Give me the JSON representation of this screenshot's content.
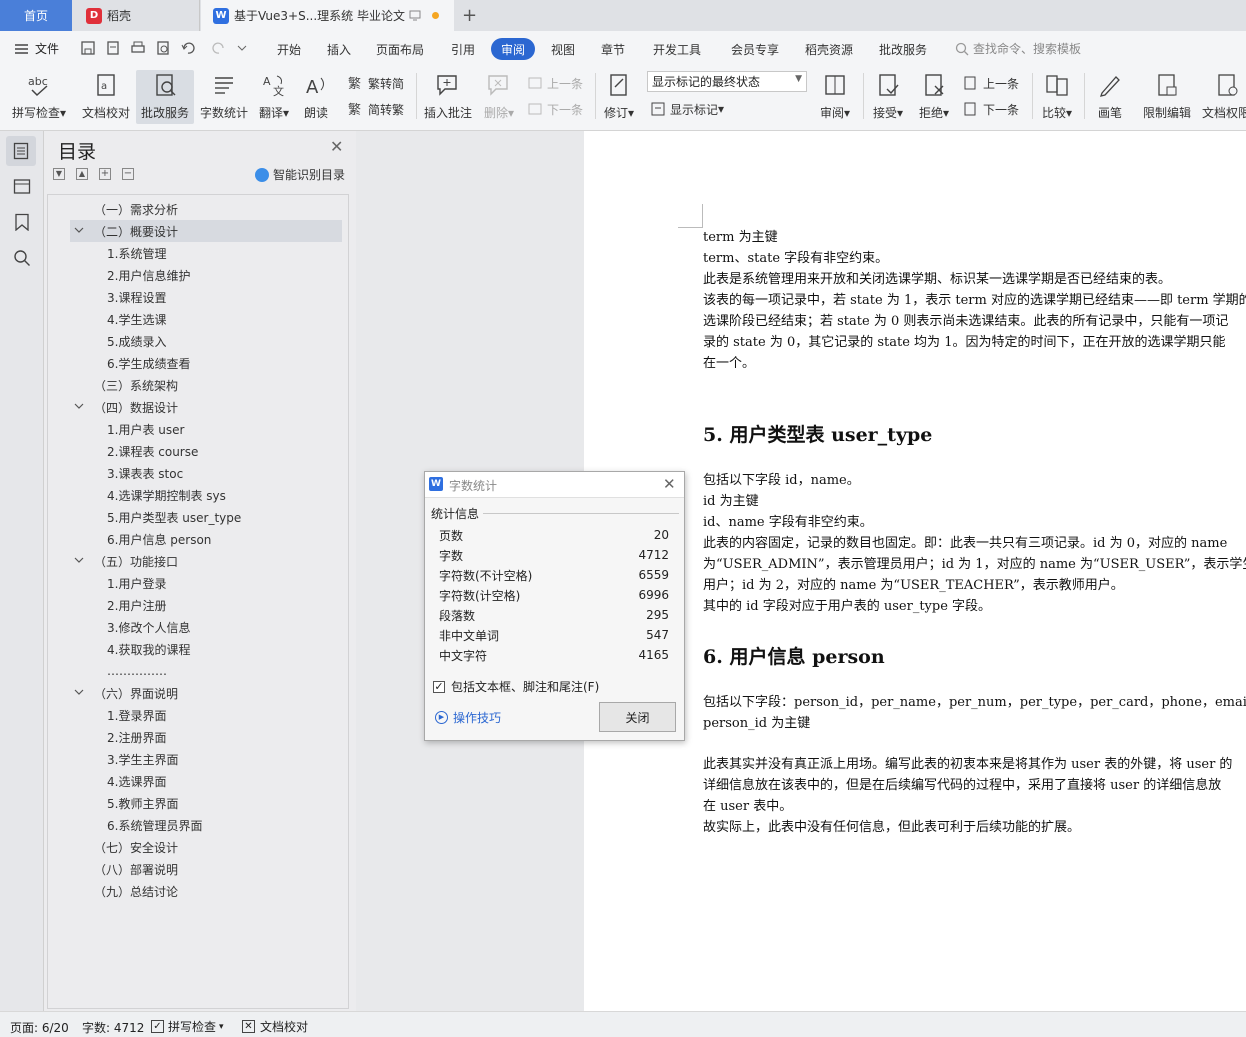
{
  "tabs": {
    "home": "首页",
    "daoke": "稻壳",
    "doc": "基于Vue3+S...理系统 毕业论文"
  },
  "menu": {
    "file": "文件",
    "items": [
      "开始",
      "插入",
      "页面布局",
      "引用",
      "审阅",
      "视图",
      "章节",
      "开发工具",
      "会员专享",
      "稻壳资源",
      "批改服务"
    ],
    "search": "查找命令、搜索模板"
  },
  "ribbon": {
    "spell": "拼写检查",
    "proof": "文档校对",
    "correct": "批改服务",
    "wordcount": "字数统计",
    "translate": "翻译",
    "read": "朗读",
    "fan2jian": "繁转简",
    "jian2fan": "简转繁",
    "insert_comment": "插入批注",
    "delete": "删除",
    "prev": "上一条",
    "next": "下一条",
    "revise": "修订",
    "markup_state": "显示标记的最终状态",
    "show_markup": "显示标记",
    "review": "审阅",
    "accept": "接受",
    "reject": "拒绝",
    "prev2": "上一条",
    "next2": "下一条",
    "compare": "比较",
    "pen": "画笔",
    "restrict": "限制编辑",
    "perm": "文档权限"
  },
  "toc": {
    "title": "目录",
    "smart": "智能识别目录",
    "items": [
      "（一）需求分析",
      "（二）概要设计",
      "1.系统管理",
      "2.用户信息维护",
      "3.课程设置",
      "4.学生选课",
      "5.成绩录入",
      "6.学生成绩查看",
      "（三）系统架构",
      "（四）数据设计",
      "1.用户表 user",
      "2.课程表 course",
      "3.课表表 stoc",
      "4.选课学期控制表 sys",
      "5.用户类型表 user_type",
      "6.用户信息 person",
      "（五）功能接口",
      "1.用户登录",
      "2.用户注册",
      "3.修改个人信息",
      "4.获取我的课程",
      "……………",
      "（六）界面说明",
      "1.登录界面",
      "2.注册界面",
      "3.学生主界面",
      "4.选课界面",
      "5.教师主界面",
      "6.系统管理员界面",
      "（七）安全设计",
      "（八）部署说明",
      "（九）总结讨论"
    ]
  },
  "doc": {
    "lines1": [
      "term 为主键",
      "term、state 字段有非空约束。",
      "此表是系统管理用来开放和关闭选课学期、标识某一选课学期是否已经结束的表。",
      "该表的每一项记录中，若 state 为 1，表示 term 对应的选课学期已经结束——即 term 学期的",
      "选课阶段已经结束；若 state 为 0 则表示尚未选课结束。此表的所有记录中，只能有一项记",
      "录的 state 为 0，其它记录的 state 均为 1。因为特定的时间下，正在开放的选课学期只能",
      "在一个。"
    ],
    "h5": "5.  用户类型表 user_type",
    "lines2": [
      "包括以下字段 id，name。",
      "id 为主键",
      "id、name 字段有非空约束。",
      "此表的内容固定，记录的数目也固定。即：此表一共只有三项记录。id 为 0，对应的 name",
      "为“USER_ADMIN”，表示管理员用户；id 为 1，对应的 name 为“USER_USER”，表示学生",
      "用户；id 为 2，对应的 name 为“USER_TEACHER”，表示教师用户。",
      "其中的 id 字段对应于用户表的 user_type  字段。"
    ],
    "h6": "6.  用户信息 person",
    "lines3": [
      "包括以下字段：person_id，per_name，per_num，per_type，per_card，phone，email",
      "person_id 为主键"
    ],
    "lines4": [
      "此表其实并没有真正派上用场。编写此表的初衷本来是将其作为 user 表的外键，将 user 的",
      "详细信息放在该表中的，但是在后续编写代码的过程中，采用了直接将 user 的详细信息放",
      "在 user 表中。",
      "故实际上，此表中没有任何信息，但此表可利于后续功能的扩展。"
    ]
  },
  "dialog": {
    "title": "字数统计",
    "section": "统计信息",
    "rows": [
      {
        "k": "页数",
        "v": "20"
      },
      {
        "k": "字数",
        "v": "4712"
      },
      {
        "k": "字符数(不计空格)",
        "v": "6559"
      },
      {
        "k": "字符数(计空格)",
        "v": "6996"
      },
      {
        "k": "段落数",
        "v": "295"
      },
      {
        "k": "非中文单词",
        "v": "547"
      },
      {
        "k": "中文字符",
        "v": "4165"
      }
    ],
    "checkbox": "包括文本框、脚注和尾注(F)",
    "tips": "操作技巧",
    "close": "关闭"
  },
  "status": {
    "page": "页面: 6/20",
    "words": "字数: 4712",
    "spell": "拼写检查",
    "proof": "文档校对"
  },
  "colors": {
    "accent": "#4a7fd9",
    "active_tab": "#2b67d1"
  }
}
